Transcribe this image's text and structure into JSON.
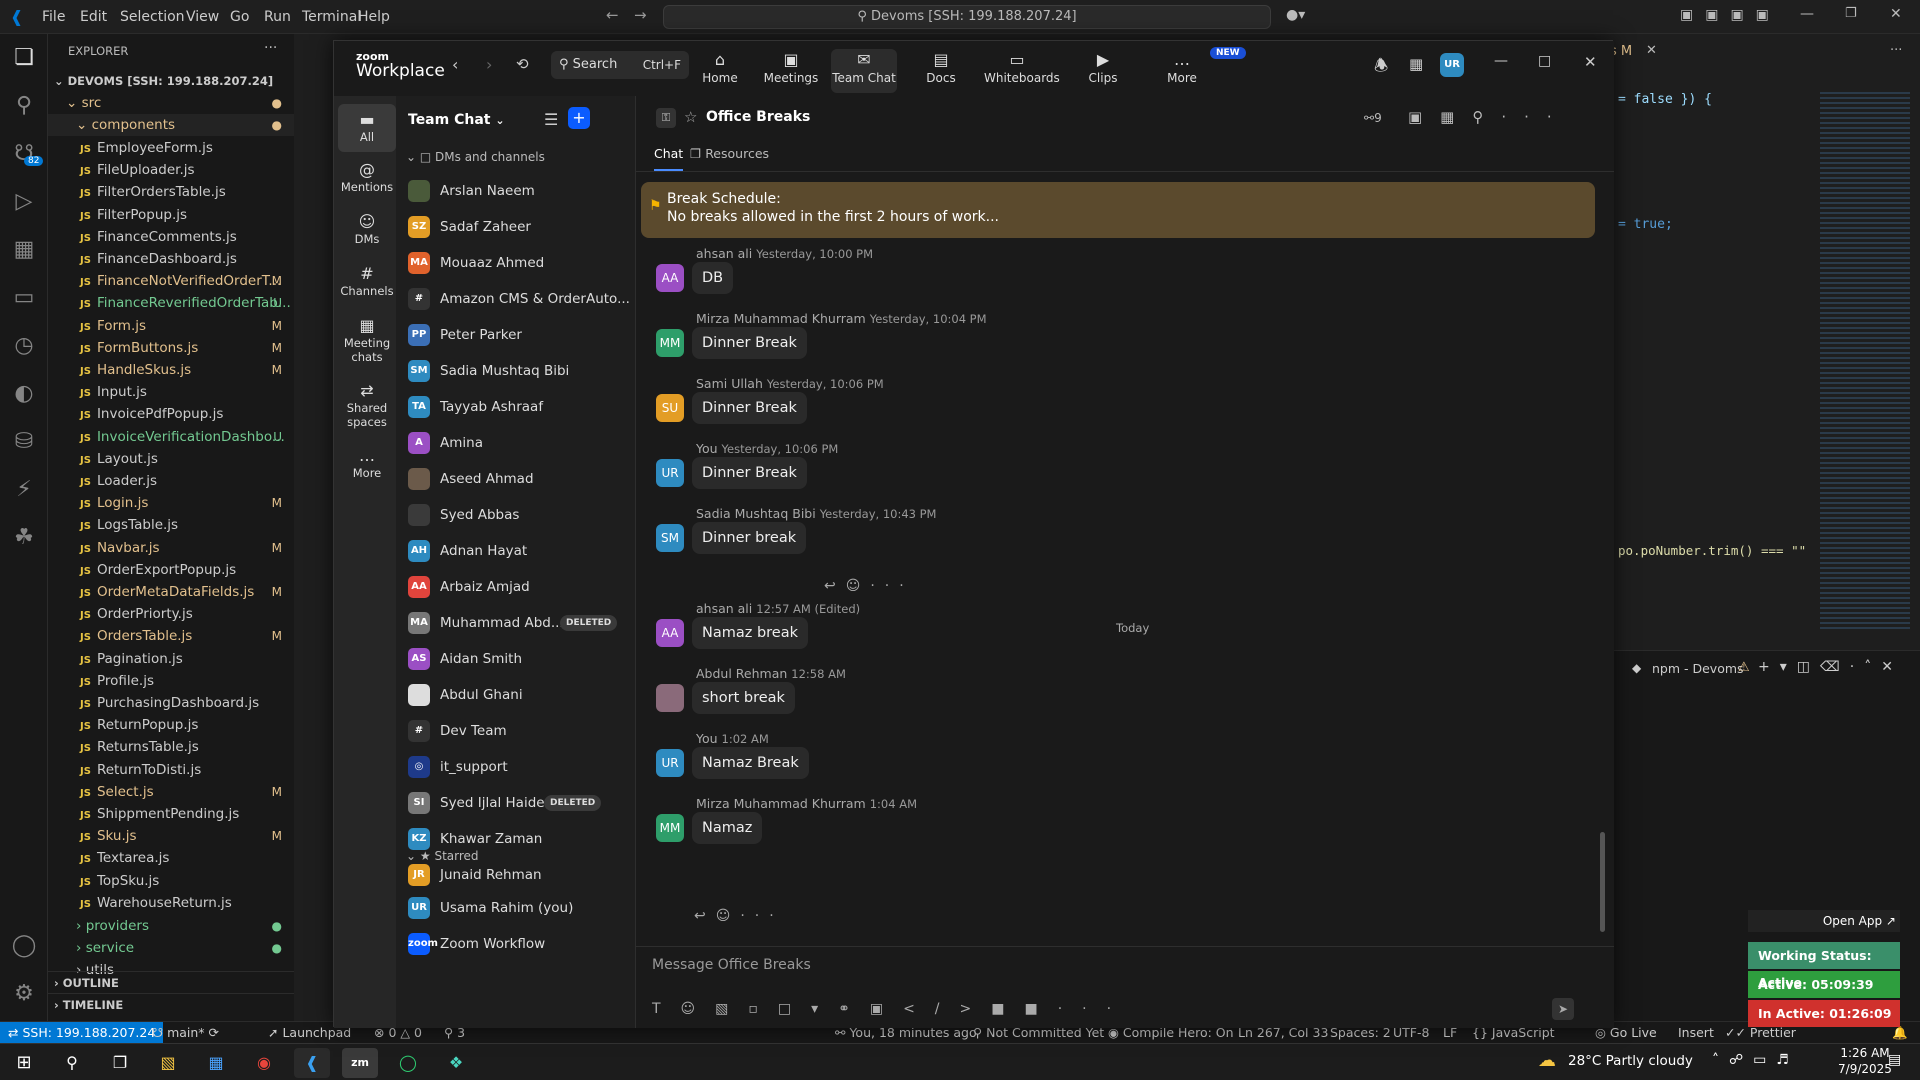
{
  "vscode": {
    "menu": [
      "File",
      "Edit",
      "Selection",
      "View",
      "Go",
      "Run",
      "Terminal",
      "Help"
    ],
    "command_center": "Devoms [SSH: 199.188.207.24]",
    "explorer_title": "EXPLORER",
    "root": "DEVOMS [SSH: 199.188.207.24]",
    "src": "src",
    "components": "components",
    "files": [
      {
        "name": "EmployeeForm.js",
        "flag": "",
        "color": "#ccc"
      },
      {
        "name": "FileUploader.js",
        "flag": "",
        "color": "#ccc"
      },
      {
        "name": "FilterOrdersTable.js",
        "flag": "",
        "color": "#ccc"
      },
      {
        "name": "FilterPopup.js",
        "flag": "",
        "color": "#ccc"
      },
      {
        "name": "FinanceComments.js",
        "flag": "",
        "color": "#ccc"
      },
      {
        "name": "FinanceDashboard.js",
        "flag": "",
        "color": "#ccc"
      },
      {
        "name": "FinanceNotVerifiedOrderT...",
        "flag": "M",
        "color": "#e2c08d"
      },
      {
        "name": "FinanceReverifiedOrderTab...",
        "flag": "U",
        "color": "#73c991"
      },
      {
        "name": "Form.js",
        "flag": "M",
        "color": "#e2c08d"
      },
      {
        "name": "FormButtons.js",
        "flag": "M",
        "color": "#e2c08d"
      },
      {
        "name": "HandleSkus.js",
        "flag": "M",
        "color": "#e2c08d"
      },
      {
        "name": "Input.js",
        "flag": "",
        "color": "#ccc"
      },
      {
        "name": "InvoicePdfPopup.js",
        "flag": "",
        "color": "#ccc"
      },
      {
        "name": "InvoiceVerificationDashbo...",
        "flag": "U",
        "color": "#73c991"
      },
      {
        "name": "Layout.js",
        "flag": "",
        "color": "#ccc"
      },
      {
        "name": "Loader.js",
        "flag": "",
        "color": "#ccc"
      },
      {
        "name": "Login.js",
        "flag": "M",
        "color": "#e2c08d"
      },
      {
        "name": "LogsTable.js",
        "flag": "",
        "color": "#ccc"
      },
      {
        "name": "Navbar.js",
        "flag": "M",
        "color": "#e2c08d"
      },
      {
        "name": "OrderExportPopup.js",
        "flag": "",
        "color": "#ccc"
      },
      {
        "name": "OrderMetaDataFields.js",
        "flag": "M",
        "color": "#e2c08d"
      },
      {
        "name": "OrderPriorty.js",
        "flag": "",
        "color": "#ccc"
      },
      {
        "name": "OrdersTable.js",
        "flag": "M",
        "color": "#e2c08d"
      },
      {
        "name": "Pagination.js",
        "flag": "",
        "color": "#ccc"
      },
      {
        "name": "Profile.js",
        "flag": "",
        "color": "#ccc"
      },
      {
        "name": "PurchasingDashboard.js",
        "flag": "",
        "color": "#ccc"
      },
      {
        "name": "ReturnPopup.js",
        "flag": "",
        "color": "#ccc"
      },
      {
        "name": "ReturnsTable.js",
        "flag": "",
        "color": "#ccc"
      },
      {
        "name": "ReturnToDisti.js",
        "flag": "",
        "color": "#ccc"
      },
      {
        "name": "Select.js",
        "flag": "M",
        "color": "#e2c08d"
      },
      {
        "name": "ShippmentPending.js",
        "flag": "",
        "color": "#ccc"
      },
      {
        "name": "Sku.js",
        "flag": "M",
        "color": "#e2c08d"
      },
      {
        "name": "Textarea.js",
        "flag": "",
        "color": "#ccc"
      },
      {
        "name": "TopSku.js",
        "flag": "",
        "color": "#ccc"
      },
      {
        "name": "WarehouseReturn.js",
        "flag": "",
        "color": "#ccc"
      }
    ],
    "folders": [
      "providers",
      "service",
      "utils"
    ],
    "outline": "OUTLINE",
    "timeline": "TIMELINE",
    "code_right_1": "= false }) {",
    "code_right_2": "= true;",
    "code_right_3": "po.poNumber.trim() === \"\"",
    "terminal_label": "npm - Devoms",
    "tab_hint": "s M",
    "statusbar": {
      "ssh": "SSH: 199.188.207.24",
      "branch": "main*",
      "launchpad": "Launchpad",
      "problems": "0 △ 0",
      "ports": "3",
      "blame": "You, 18 minutes ago",
      "commit": "Not Committed Yet",
      "compile": "Compile Hero: On",
      "position": "Ln 267, Col 33",
      "spaces": "Spaces: 2",
      "encoding": "UTF-8",
      "eol": "LF",
      "language": "JavaScript",
      "golive": "Go Live",
      "insert": "Insert",
      "prettier": "Prettier"
    }
  },
  "zoom": {
    "brand_small": "zoom",
    "brand": "Workplace",
    "search": "Search",
    "search_shortcut": "Ctrl+F",
    "tabs": [
      {
        "label": "Home",
        "icon": "⌂"
      },
      {
        "label": "Meetings",
        "icon": "▣"
      },
      {
        "label": "Team Chat",
        "icon": "✉"
      },
      {
        "label": "Docs",
        "icon": "▤"
      },
      {
        "label": "Whiteboards",
        "icon": "▭"
      },
      {
        "label": "Clips",
        "icon": "▶"
      },
      {
        "label": "More",
        "icon": "…"
      }
    ],
    "new_badge": "NEW",
    "user_initials": "UR",
    "rail": [
      {
        "label": "All",
        "icon": "▬"
      },
      {
        "label": "Mentions",
        "icon": "@"
      },
      {
        "label": "DMs",
        "icon": "☺"
      },
      {
        "label": "Channels",
        "icon": "#"
      },
      {
        "label": "Meeting chats",
        "icon": "▦"
      },
      {
        "label": "Shared spaces",
        "icon": "⇄"
      },
      {
        "label": "More",
        "icon": "…"
      }
    ],
    "list_title": "Team Chat",
    "section_dms": "DMs and channels",
    "section_starred": "Starred",
    "deleted": "DELETED",
    "contacts": [
      {
        "name": "Arslan Naeem",
        "initials": "",
        "color": "#4a5a3a"
      },
      {
        "name": "Sadaf Zaheer",
        "initials": "SZ",
        "color": "#e39d25"
      },
      {
        "name": "Mouaaz Ahmed",
        "initials": "MA",
        "color": "#e0622c"
      },
      {
        "name": "Amazon CMS & OrderAuto...",
        "initials": "#",
        "color": "#333"
      },
      {
        "name": "Peter Parker",
        "initials": "PP",
        "color": "#3b6fb6"
      },
      {
        "name": "Sadia Mushtaq Bibi",
        "initials": "SM",
        "color": "#2e8bc0"
      },
      {
        "name": "Tayyab Ashraaf",
        "initials": "TA",
        "color": "#2e8bc0"
      },
      {
        "name": "Amina",
        "initials": "A",
        "color": "#9b4fc4"
      },
      {
        "name": "Aseed Ahmad",
        "initials": "",
        "color": "#6b5a4a"
      },
      {
        "name": "Syed Abbas",
        "initials": "",
        "color": "#3a3a3a"
      },
      {
        "name": "Adnan Hayat",
        "initials": "AH",
        "color": "#2e8bc0"
      },
      {
        "name": "Arbaiz Amjad",
        "initials": "AA",
        "color": "#e0443c"
      },
      {
        "name": "Muhammad Abd...",
        "initials": "MA",
        "color": "#777"
      },
      {
        "name": "Aidan Smith",
        "initials": "AS",
        "color": "#9b4fc4"
      },
      {
        "name": "Abdul Ghani",
        "initials": "",
        "color": "#ddd"
      },
      {
        "name": "Dev Team",
        "initials": "#",
        "color": "#333"
      },
      {
        "name": "it_support",
        "initials": "◎",
        "color": "#1e3a8a"
      },
      {
        "name": "Syed Ijlal Haider",
        "initials": "SI",
        "color": "#777"
      },
      {
        "name": "Khawar Zaman",
        "initials": "KZ",
        "color": "#2e8bc0"
      },
      {
        "name": "Junaid Rehman",
        "initials": "JR",
        "color": "#e39d25"
      }
    ],
    "starred": [
      {
        "name": "Usama Rahim (you)",
        "initials": "UR",
        "color": "#2e8bc0"
      },
      {
        "name": "Zoom Workflow",
        "initials": "zoom",
        "color": "#0b5cff"
      }
    ],
    "channel": {
      "name": "Office Breaks",
      "members": "9",
      "tab_chat": "Chat",
      "tab_resources": "Resources",
      "pinned_title": "Break Schedule:",
      "pinned_text": "No breaks allowed in the first 2 hours of work...",
      "day_divider": "Today",
      "composer_placeholder": "Message Office Breaks"
    },
    "messages": [
      {
        "name": "ahsan ali",
        "time": "Yesterday, 10:00 PM",
        "text": "DB",
        "initials": "AA",
        "color": "#9b4fc4"
      },
      {
        "name": "Mirza Muhammad Khurram",
        "time": "Yesterday, 10:04 PM",
        "text": "Dinner Break",
        "initials": "MM",
        "color": "#2e9e6a"
      },
      {
        "name": "Sami Ullah",
        "time": "Yesterday, 10:06 PM",
        "text": "Dinner Break",
        "initials": "SU",
        "color": "#e39d25"
      },
      {
        "name": "You",
        "time": "Yesterday, 10:06 PM",
        "text": "Dinner Break",
        "initials": "UR",
        "color": "#2e8bc0"
      },
      {
        "name": "Sadia Mushtaq Bibi",
        "time": "Yesterday, 10:43 PM",
        "text": "Dinner break",
        "initials": "SM",
        "color": "#2e8bc0"
      },
      {
        "name": "ahsan ali",
        "time": "12:57 AM (Edited)",
        "text": "Namaz break",
        "initials": "AA",
        "color": "#9b4fc4"
      },
      {
        "name": "Abdul Rehman",
        "time": "12:58 AM",
        "text": "short break",
        "initials": "",
        "color": "#8a6a7a"
      },
      {
        "name": "You",
        "time": "1:02 AM",
        "text": "Namaz Break",
        "initials": "UR",
        "color": "#2e8bc0"
      },
      {
        "name": "Mirza Muhammad Khurram",
        "time": "1:04 AM",
        "text": "Namaz",
        "initials": "MM",
        "color": "#2e9e6a"
      }
    ]
  },
  "status_widget": {
    "open_app": "Open App ↗",
    "working": "Working Status: Active",
    "active": "Active: 05:09:39",
    "inactive": "In Active: 01:26:09"
  },
  "taskbar": {
    "weather": "28°C  Partly cloudy",
    "time": "1:26 AM",
    "date": "7/9/2025"
  }
}
